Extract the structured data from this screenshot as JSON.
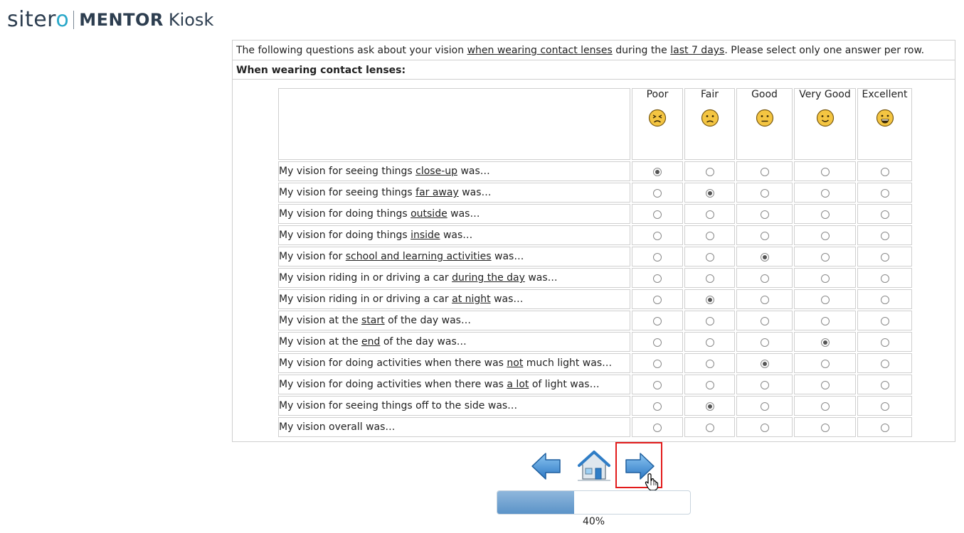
{
  "header": {
    "brand_main": "siter",
    "brand_tail": "o",
    "product": "MENTOR",
    "product_suffix": "Kiosk"
  },
  "survey": {
    "instructions": {
      "pre": "The following questions ask about your vision ",
      "u1": "when wearing contact lenses",
      "mid": " during the ",
      "u2": "last 7 days",
      "post": ". Please select only one answer per row."
    },
    "subhead": "When wearing contact lenses:",
    "columns": [
      {
        "label": "Poor",
        "icon": "poor-face-icon"
      },
      {
        "label": "Fair",
        "icon": "fair-face-icon"
      },
      {
        "label": "Good",
        "icon": "good-face-icon"
      },
      {
        "label": "Very Good",
        "icon": "very-good-face-icon"
      },
      {
        "label": "Excellent",
        "icon": "excellent-face-icon"
      }
    ],
    "rows": [
      {
        "pre": "My vision for seeing things ",
        "u": "close-up",
        "post": " was…",
        "selected": 0
      },
      {
        "pre": "My vision for seeing things ",
        "u": "far away",
        "post": " was…",
        "selected": 1
      },
      {
        "pre": "My vision for doing things ",
        "u": "outside",
        "post": " was…",
        "selected": null
      },
      {
        "pre": "My vision for doing things ",
        "u": "inside",
        "post": " was…",
        "selected": null
      },
      {
        "pre": "My vision for ",
        "u": "school and learning activities",
        "post": " was…",
        "selected": 2
      },
      {
        "pre": "My vision riding in or driving a car ",
        "u": "during the day",
        "post": " was…",
        "selected": null
      },
      {
        "pre": "My vision riding in or driving a car ",
        "u": "at night",
        "post": " was…",
        "selected": 1
      },
      {
        "pre": "My vision at the ",
        "u": "start",
        "post": " of the day was…",
        "selected": null
      },
      {
        "pre": "My vision at the ",
        "u": "end",
        "post": " of the day was…",
        "selected": 3
      },
      {
        "pre": "My vision for doing activities when there was ",
        "u": "not",
        "post": " much light was…",
        "selected": 2
      },
      {
        "pre": "My vision for doing activities when there was ",
        "u": "a lot",
        "post": " of light was…",
        "selected": null
      },
      {
        "pre": "My vision for seeing things off to the side was…",
        "u": "",
        "post": "",
        "selected": 1
      },
      {
        "pre": "My vision overall was…",
        "u": "",
        "post": "",
        "selected": null
      }
    ]
  },
  "navigation": {
    "back_icon": "back-arrow-icon",
    "home_icon": "home-icon",
    "next_icon": "next-arrow-icon"
  },
  "progress": {
    "value": 0.4,
    "label": "40%"
  },
  "colors": {
    "accent": "#2aa8c9",
    "nav_blue": "#3d8fd6",
    "highlight_frame": "#e21b1b",
    "face_yellow": "#f4c542"
  }
}
